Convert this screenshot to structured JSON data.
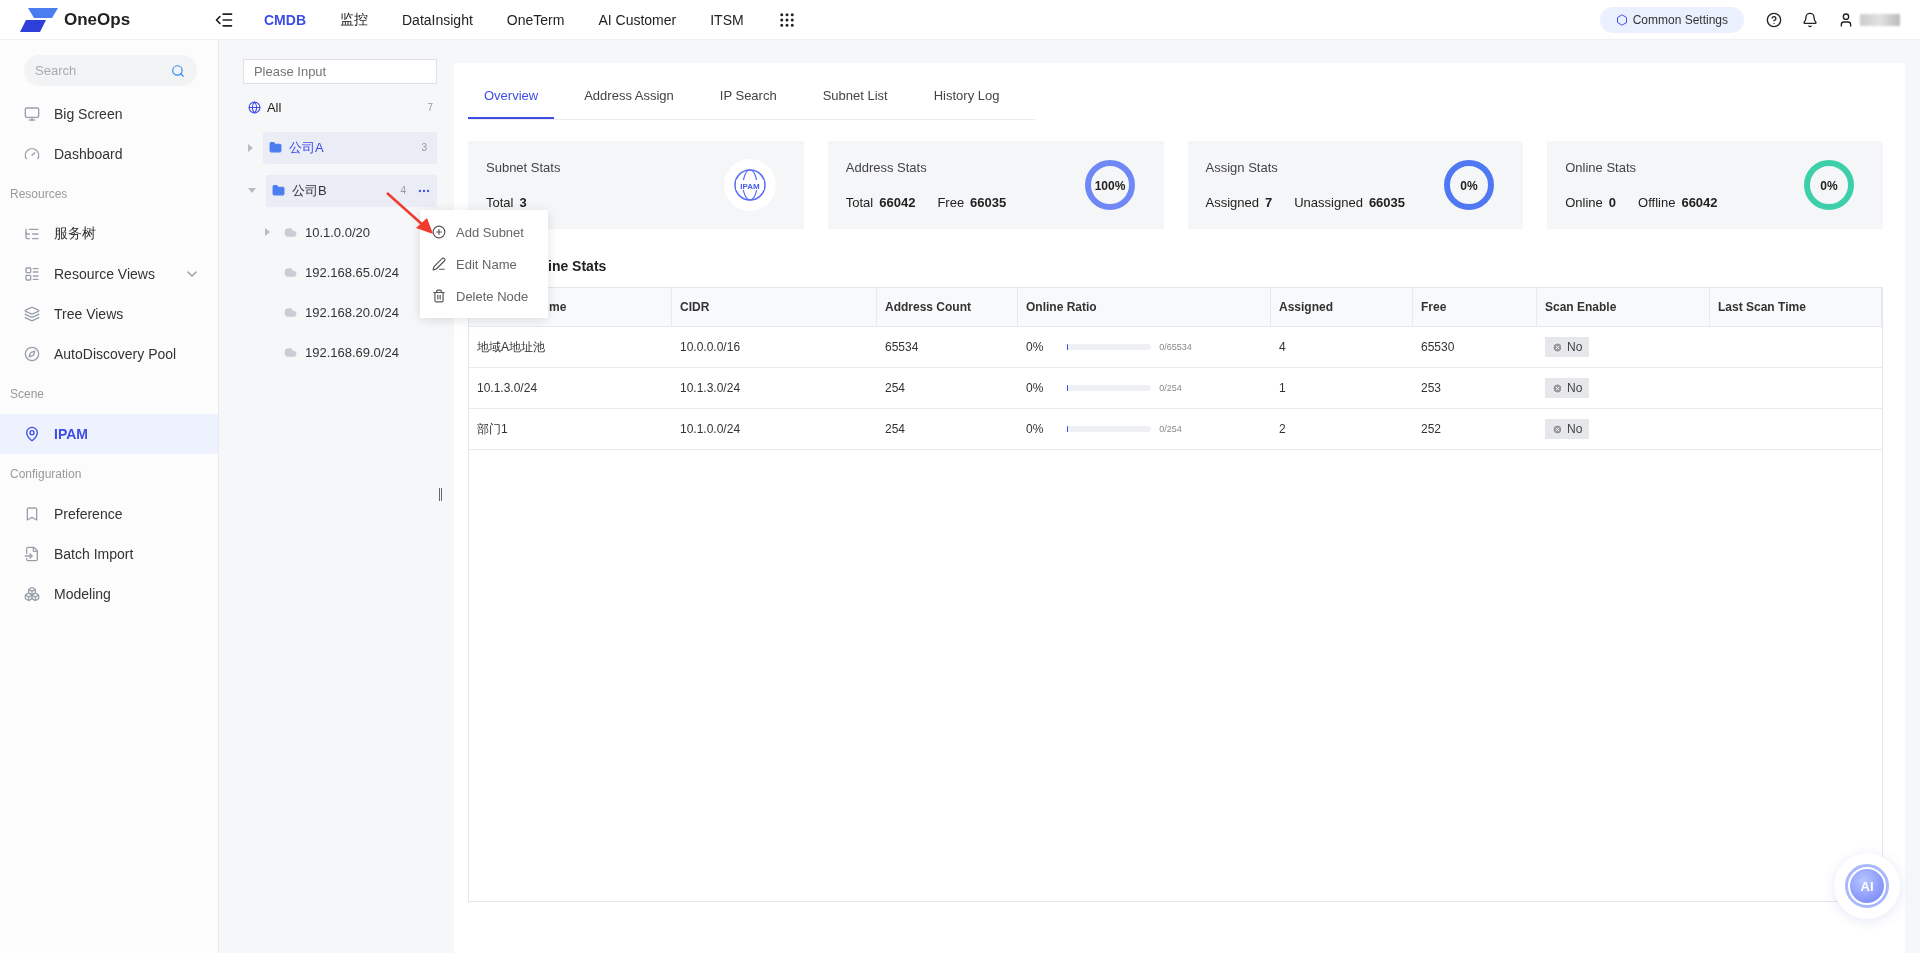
{
  "brand": {
    "name": "OneOps"
  },
  "nav": [
    {
      "label": "CMDB",
      "selected": true
    },
    {
      "label": "监控",
      "selected": false
    },
    {
      "label": "DataInsight",
      "selected": false
    },
    {
      "label": "OneTerm",
      "selected": false
    },
    {
      "label": "AI Customer",
      "selected": false
    },
    {
      "label": "ITSM",
      "selected": false
    }
  ],
  "header": {
    "settings": "Common Settings"
  },
  "sidebar": {
    "search_placeholder": "Search",
    "items": [
      {
        "kind": "item",
        "label": "Big Screen",
        "selected": false
      },
      {
        "kind": "item",
        "label": "Dashboard",
        "selected": false
      },
      {
        "kind": "section",
        "label": "Resources"
      },
      {
        "kind": "item",
        "label": "服务树",
        "selected": false
      },
      {
        "kind": "group",
        "label": "Resource Views",
        "selected": false
      },
      {
        "kind": "item",
        "label": "Tree Views",
        "selected": false
      },
      {
        "kind": "item",
        "label": "AutoDiscovery Pool",
        "selected": false
      },
      {
        "kind": "section",
        "label": "Scene"
      },
      {
        "kind": "item",
        "label": "IPAM",
        "selected": true
      },
      {
        "kind": "section",
        "label": "Configuration"
      },
      {
        "kind": "item",
        "label": "Preference",
        "selected": false
      },
      {
        "kind": "item",
        "label": "Batch Import",
        "selected": false
      },
      {
        "kind": "item",
        "label": "Modeling",
        "selected": false
      }
    ]
  },
  "tree": {
    "placeholder": "Please Input",
    "root": {
      "label": "All",
      "count": "7"
    },
    "nodes": [
      {
        "label": "公司A",
        "count": "3",
        "selected": true,
        "expanded": false,
        "hovered": false
      },
      {
        "label": "公司B",
        "count": "4",
        "selected": false,
        "expanded": true,
        "hovered": true,
        "children": [
          {
            "label": "10.1.0.0/20",
            "expandable": true
          },
          {
            "label": "192.168.65.0/24",
            "expandable": false
          },
          {
            "label": "192.168.20.0/24",
            "expandable": false
          },
          {
            "label": "192.168.69.0/24",
            "expandable": false
          }
        ]
      }
    ]
  },
  "context_menu": {
    "items": [
      {
        "label": "Add Subnet"
      },
      {
        "label": "Edit Name"
      },
      {
        "label": "Delete Node"
      }
    ]
  },
  "tabs": [
    {
      "label": "Overview",
      "selected": true
    },
    {
      "label": "Address Assign",
      "selected": false
    },
    {
      "label": "IP Search",
      "selected": false
    },
    {
      "label": "Subnet List",
      "selected": false
    },
    {
      "label": "History Log",
      "selected": false
    }
  ],
  "stats": [
    {
      "kind": "logo",
      "title": "Subnet Stats",
      "logo_text": "IPAM",
      "fields": [
        {
          "label": "Total",
          "value": "3"
        }
      ]
    },
    {
      "kind": "ring",
      "title": "Address Stats",
      "percent": "100%",
      "color": "#7088f6",
      "fields": [
        {
          "label": "Total",
          "value": "66042"
        },
        {
          "label": "Free",
          "value": "66035"
        }
      ]
    },
    {
      "kind": "ring",
      "title": "Assign Stats",
      "percent": "0%",
      "color": "#4f78f3",
      "fields": [
        {
          "label": "Assigned",
          "value": "7"
        },
        {
          "label": "Unassigned",
          "value": "66035"
        }
      ]
    },
    {
      "kind": "ring",
      "title": "Online Stats",
      "percent": "0%",
      "color": "#3ccfa9",
      "fields": [
        {
          "label": "Online",
          "value": "0"
        },
        {
          "label": "Offline",
          "value": "66042"
        }
      ]
    }
  ],
  "table": {
    "heading": "ine Stats",
    "columns": [
      "me",
      "CIDR",
      "Address Count",
      "Online Ratio",
      "Assigned",
      "Free",
      "Scan Enable",
      "Last Scan Time"
    ],
    "rows": [
      {
        "name": "地域A地址池",
        "cidr": "10.0.0.0/16",
        "count": "65534",
        "ratio": "0%",
        "level": 0,
        "ratio_reading": "0/65534",
        "assigned": "4",
        "free": "65530",
        "scan_enabled": false,
        "scan_label": "No"
      },
      {
        "name": "10.1.3.0/24",
        "cidr": "10.1.3.0/24",
        "count": "254",
        "ratio": "0%",
        "level": 0,
        "ratio_reading": "0/254",
        "assigned": "1",
        "free": "253",
        "scan_enabled": false,
        "scan_label": "No"
      },
      {
        "name": "部门1",
        "cidr": "10.1.0.0/24",
        "count": "254",
        "ratio": "0%",
        "level": 0,
        "ratio_reading": "0/254",
        "assigned": "2",
        "free": "252",
        "scan_enabled": false,
        "scan_label": "No"
      }
    ]
  },
  "assistant": {
    "label": "AI"
  }
}
